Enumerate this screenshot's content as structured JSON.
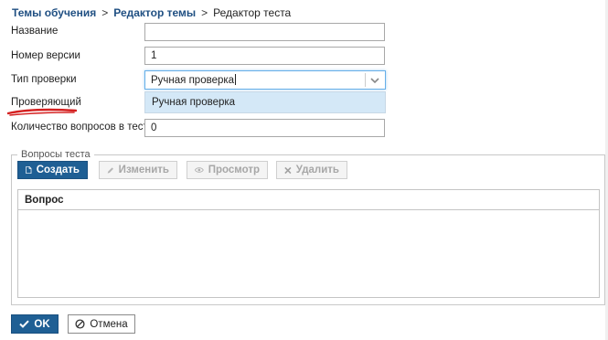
{
  "breadcrumb": {
    "items": [
      "Темы обучения",
      "Редактор темы"
    ],
    "separator": ">",
    "current": "Редактор теста"
  },
  "form": {
    "name": {
      "label": "Название",
      "value": ""
    },
    "version": {
      "label": "Номер версии",
      "value": "1"
    },
    "check_type": {
      "label": "Тип проверки",
      "value": "Ручная проверка",
      "options": [
        "Ручная проверка"
      ]
    },
    "reviewer": {
      "label": "Проверяющий"
    },
    "question_count": {
      "label": "Количество вопросов в тесте",
      "value": "0"
    }
  },
  "questions": {
    "legend": "Вопросы теста",
    "toolbar": {
      "create": "Создать",
      "edit": "Изменить",
      "view": "Просмотр",
      "delete": "Удалить"
    },
    "grid": {
      "columns": [
        "Вопрос"
      ],
      "rows": []
    }
  },
  "footer": {
    "ok": "OK",
    "cancel": "Отмена"
  },
  "colors": {
    "primary": "#1f5f94",
    "link": "#1f4f82",
    "highlight": "#d4e8f7",
    "annotation": "#d42020"
  }
}
